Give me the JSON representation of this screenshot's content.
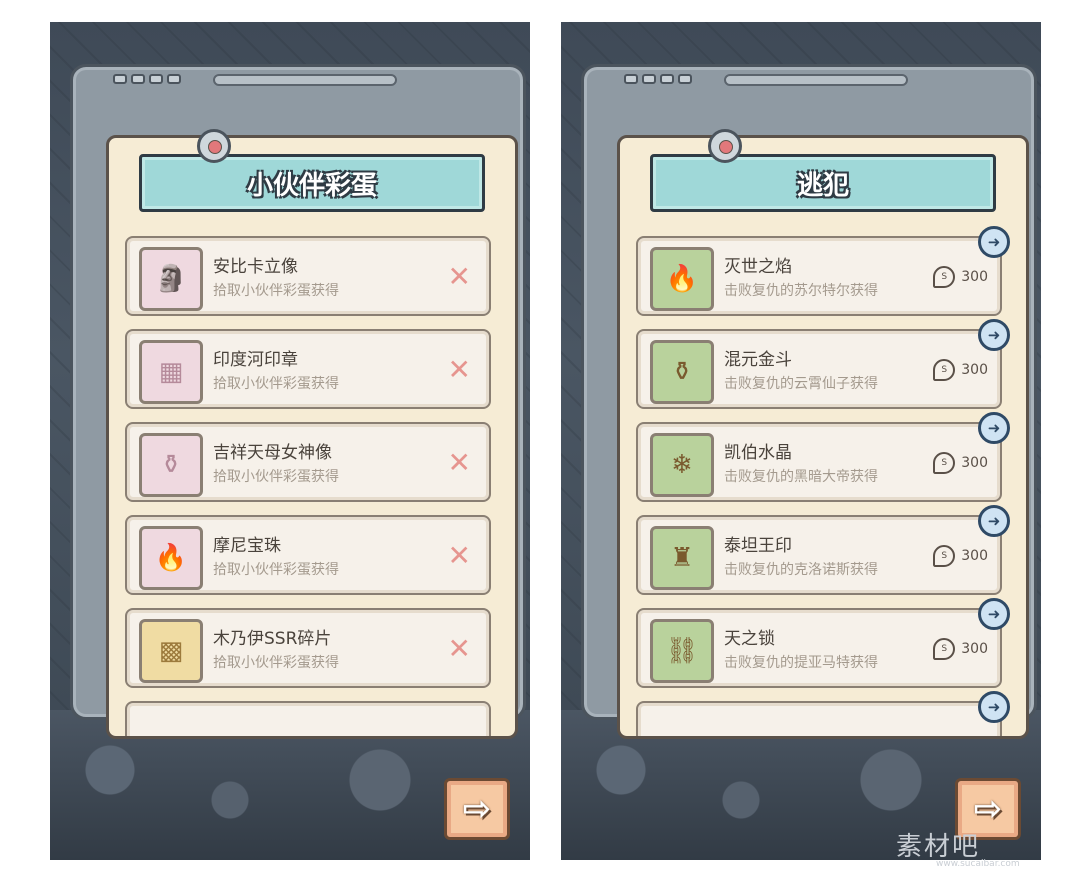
{
  "left_screen": {
    "title": "小伙伴彩蛋",
    "items": [
      {
        "name": "安比卡立像",
        "desc": "拾取小伙伴彩蛋获得",
        "status": "✕",
        "glyph": "🗿",
        "tone": "pink"
      },
      {
        "name": "印度河印章",
        "desc": "拾取小伙伴彩蛋获得",
        "status": "✕",
        "glyph": "▦",
        "tone": "pink"
      },
      {
        "name": "吉祥天母女神像",
        "desc": "拾取小伙伴彩蛋获得",
        "status": "✕",
        "glyph": "⚱",
        "tone": "pink"
      },
      {
        "name": "摩尼宝珠",
        "desc": "拾取小伙伴彩蛋获得",
        "status": "✕",
        "glyph": "🔥",
        "tone": "pink"
      },
      {
        "name": "木乃伊SSR碎片",
        "desc": "拾取小伙伴彩蛋获得",
        "status": "✕",
        "glyph": "▩",
        "tone": "gold"
      }
    ]
  },
  "right_screen": {
    "title": "逃犯",
    "items": [
      {
        "name": "灭世之焰",
        "desc": "击败复仇的苏尔特尔获得",
        "reward": "300",
        "glyph": "🔥"
      },
      {
        "name": "混元金斗",
        "desc": "击败复仇的云霄仙子获得",
        "reward": "300",
        "glyph": "⚱"
      },
      {
        "name": "凯伯水晶",
        "desc": "击败复仇的黑暗大帝获得",
        "reward": "300",
        "glyph": "❄"
      },
      {
        "name": "泰坦王印",
        "desc": "击败复仇的克洛诺斯获得",
        "reward": "300",
        "glyph": "♜"
      },
      {
        "name": "天之锁",
        "desc": "击败复仇的提亚马特获得",
        "reward": "300",
        "glyph": "⛓"
      }
    ]
  },
  "icons": {
    "arrow_badge": "➜",
    "next_arrow": "⇨",
    "coin": "S"
  },
  "watermark": {
    "text": "素材吧",
    "sub": "www.sucaibar.com"
  }
}
